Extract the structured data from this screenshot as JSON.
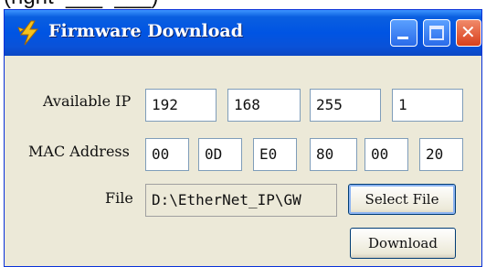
{
  "caption": "(right  ___  ___)",
  "window": {
    "title": "Firmware Download",
    "icon": "lightning-icon",
    "controls": {
      "minimize": "minimize-icon",
      "maximize": "maximize-icon",
      "close": "✕"
    }
  },
  "form": {
    "ip": {
      "label": "Available IP",
      "octets": [
        "192",
        "168",
        "255",
        "1"
      ]
    },
    "mac": {
      "label": "MAC Address",
      "bytes": [
        "00",
        "0D",
        "E0",
        "80",
        "00",
        "20"
      ]
    },
    "file": {
      "label": "File",
      "value": "D:\\EtherNet_IP\\GW"
    },
    "buttons": {
      "select_file": "Select File",
      "download": "Download"
    }
  }
}
